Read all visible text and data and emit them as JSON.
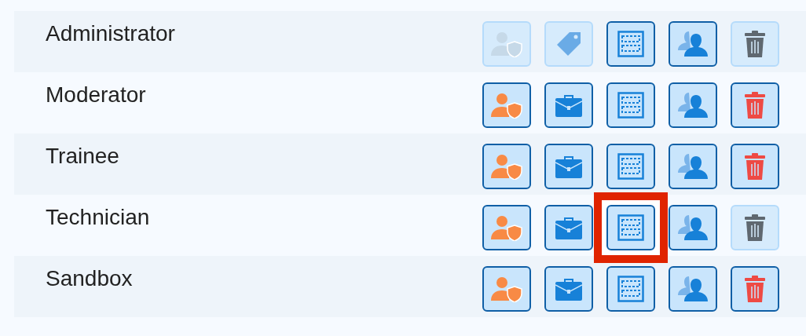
{
  "roles": [
    {
      "name": "Administrator",
      "actions": [
        {
          "kind": "role",
          "disabled": true
        },
        {
          "kind": "tag",
          "disabled": true
        },
        {
          "kind": "layout",
          "disabled": false
        },
        {
          "kind": "users",
          "disabled": false
        },
        {
          "kind": "delete",
          "disabled": true
        }
      ]
    },
    {
      "name": "Moderator",
      "actions": [
        {
          "kind": "role",
          "disabled": false
        },
        {
          "kind": "briefcase",
          "disabled": false
        },
        {
          "kind": "layout",
          "disabled": false
        },
        {
          "kind": "users",
          "disabled": false
        },
        {
          "kind": "delete",
          "disabled": false
        }
      ]
    },
    {
      "name": "Trainee",
      "actions": [
        {
          "kind": "role",
          "disabled": false
        },
        {
          "kind": "briefcase",
          "disabled": false
        },
        {
          "kind": "layout",
          "disabled": false
        },
        {
          "kind": "users",
          "disabled": false
        },
        {
          "kind": "delete",
          "disabled": false
        }
      ]
    },
    {
      "name": "Technician",
      "actions": [
        {
          "kind": "role",
          "disabled": false
        },
        {
          "kind": "briefcase",
          "disabled": false
        },
        {
          "kind": "layout",
          "disabled": false,
          "highlighted": true
        },
        {
          "kind": "users",
          "disabled": false
        },
        {
          "kind": "delete",
          "disabled": true
        }
      ]
    },
    {
      "name": "Sandbox",
      "actions": [
        {
          "kind": "role",
          "disabled": false
        },
        {
          "kind": "briefcase",
          "disabled": false
        },
        {
          "kind": "layout",
          "disabled": false
        },
        {
          "kind": "users",
          "disabled": false
        },
        {
          "kind": "delete",
          "disabled": false
        }
      ]
    }
  ]
}
